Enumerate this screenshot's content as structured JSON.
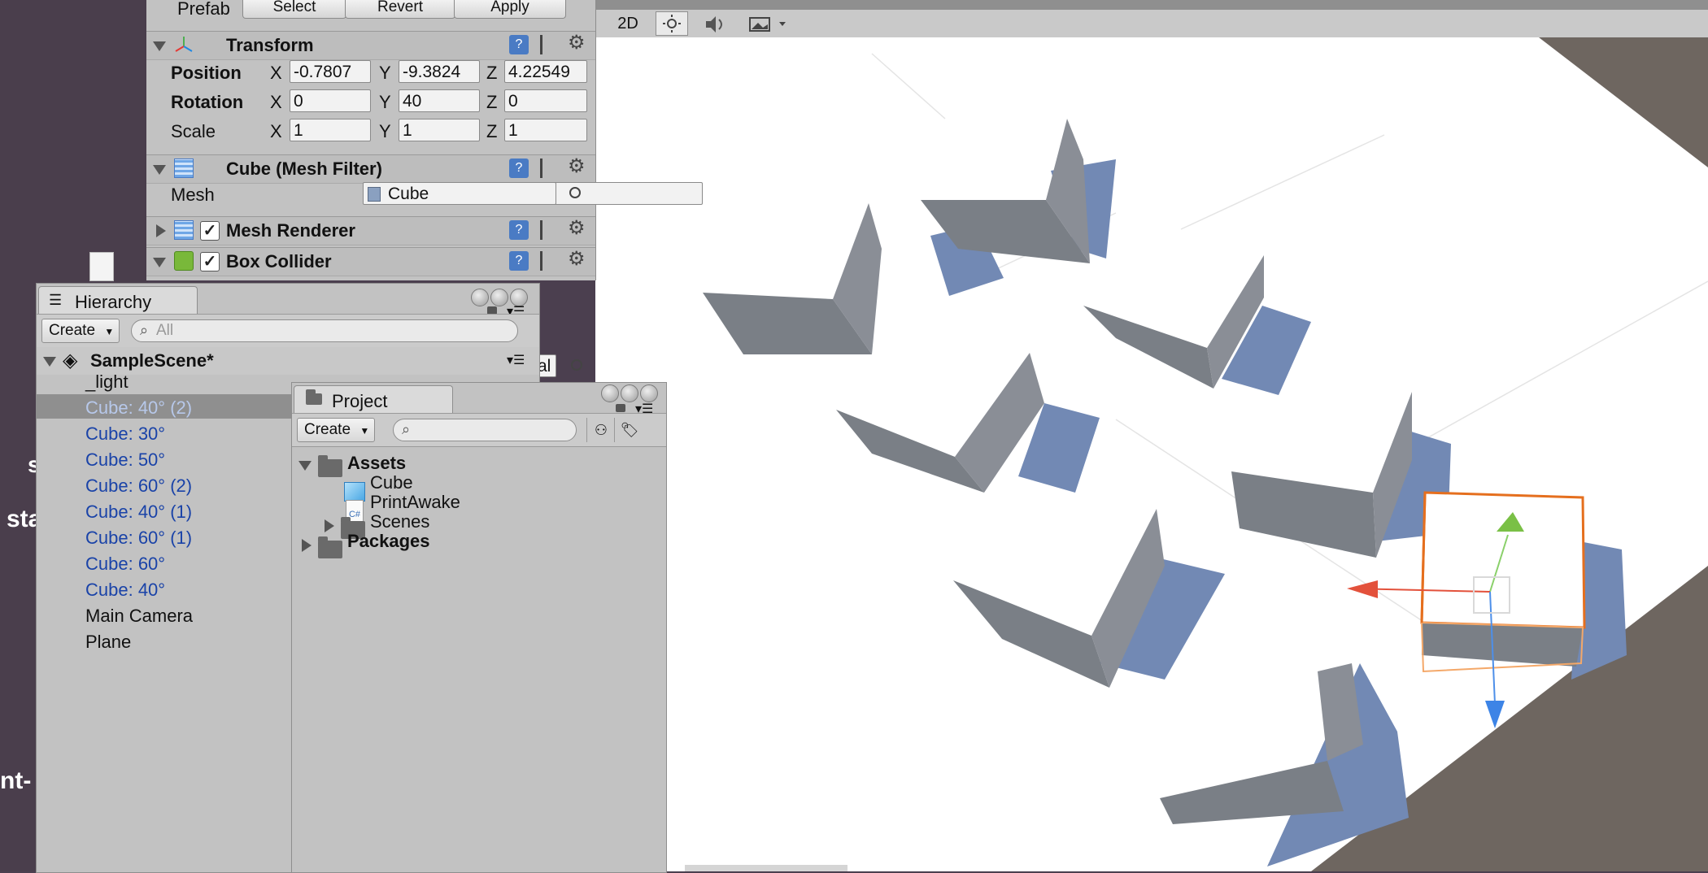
{
  "desktop": {
    "fragments": [
      "s",
      "sta",
      "nt-"
    ]
  },
  "inspector": {
    "prefab_label": "Prefab",
    "prefab_buttons": [
      "Select",
      "Revert",
      "Apply"
    ],
    "transform": {
      "title": "Transform",
      "position_label": "Position",
      "rotation_label": "Rotation",
      "scale_label": "Scale",
      "axis_x": "X",
      "axis_y": "Y",
      "axis_z": "Z",
      "position": {
        "x": "-0.7807",
        "y": "-9.3824",
        "z": "4.22549"
      },
      "rotation": {
        "x": "0",
        "y": "40",
        "z": "0"
      },
      "scale": {
        "x": "1",
        "y": "1",
        "z": "1"
      }
    },
    "mesh_filter": {
      "title": "Cube (Mesh Filter)",
      "mesh_label": "Mesh",
      "mesh_value": "Cube"
    },
    "mesh_renderer": {
      "title": "Mesh Renderer",
      "enabled": true
    },
    "box_collider": {
      "title": "Box Collider",
      "enabled": true
    },
    "partial_field": "al"
  },
  "scene_toolbar": {
    "mode_2d": "2D"
  },
  "hierarchy": {
    "tab_label": "Hierarchy",
    "create_label": "Create",
    "search_placeholder": "All",
    "scene_name": "SampleScene*",
    "items": [
      {
        "label": "_light",
        "prefab": false,
        "selected": false
      },
      {
        "label": "Cube: 40° (2)",
        "prefab": true,
        "selected": true
      },
      {
        "label": "Cube: 30°",
        "prefab": true,
        "selected": false
      },
      {
        "label": "Cube: 50°",
        "prefab": true,
        "selected": false
      },
      {
        "label": "Cube: 60° (2)",
        "prefab": true,
        "selected": false
      },
      {
        "label": "Cube: 40° (1)",
        "prefab": true,
        "selected": false
      },
      {
        "label": "Cube: 60° (1)",
        "prefab": true,
        "selected": false
      },
      {
        "label": "Cube: 60°",
        "prefab": true,
        "selected": false
      },
      {
        "label": "Cube: 40°",
        "prefab": true,
        "selected": false
      },
      {
        "label": "Main Camera",
        "prefab": false,
        "selected": false
      },
      {
        "label": "Plane",
        "prefab": false,
        "selected": false
      }
    ]
  },
  "project": {
    "tab_label": "Project",
    "create_label": "Create",
    "search_placeholder": "",
    "tree": {
      "assets": "Assets",
      "cube": "Cube",
      "print_awake": "PrintAwake",
      "cs_badge": "C#",
      "scenes": "Scenes",
      "packages": "Packages"
    }
  }
}
